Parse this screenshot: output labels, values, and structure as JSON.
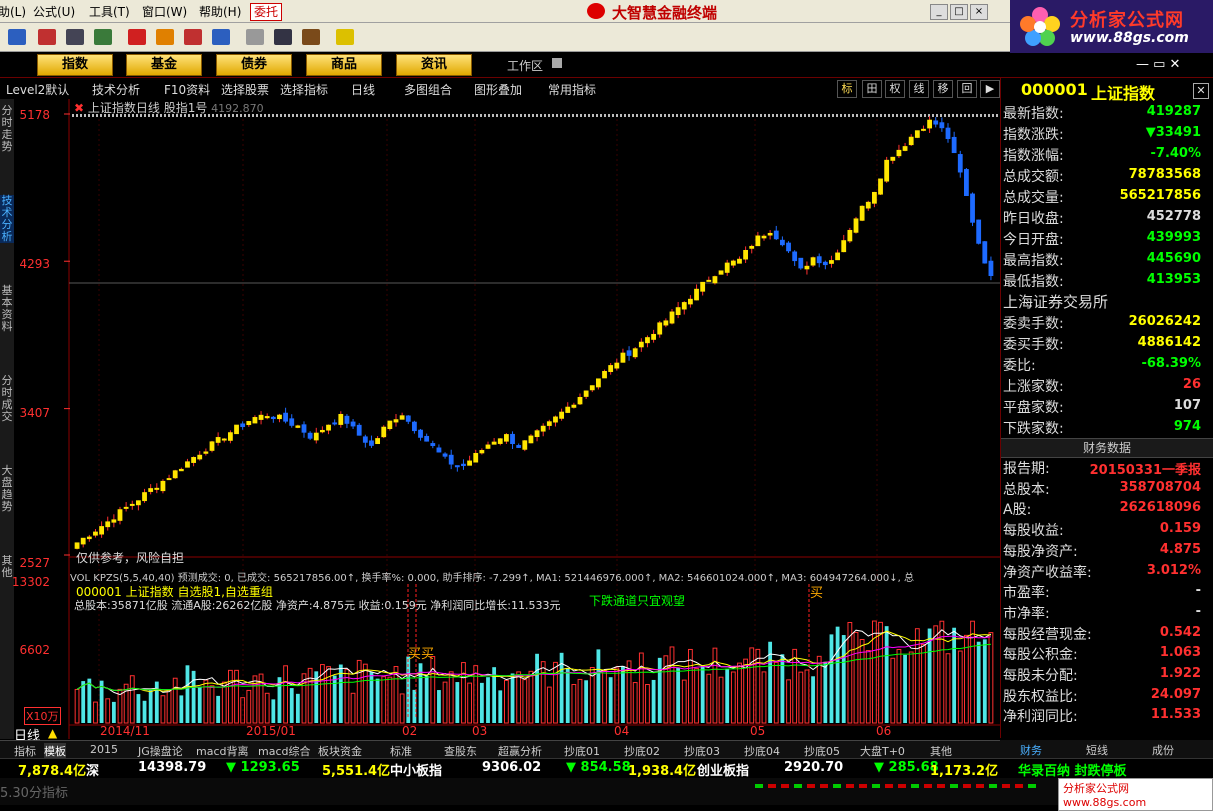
{
  "menu": {
    "items": [
      "助(L)",
      "公式(U)",
      "工具(T)",
      "窗口(W)",
      "帮助(H)"
    ],
    "trust_button": "委托",
    "app_title": "大智慧金融终端"
  },
  "brand": {
    "name": "分析家公式网",
    "url": "www.88gs.com"
  },
  "nav": {
    "tabs": [
      "指数",
      "基金",
      "债券",
      "商品",
      "资讯"
    ],
    "workarea": "工作区"
  },
  "subbar": {
    "items": [
      "Level2默认",
      "技术分析",
      "F10资料",
      "选择股票",
      "选择指标",
      "日线",
      "多图组合",
      "图形叠加",
      "常用指标"
    ],
    "right_buttons": [
      "标",
      "田",
      "权",
      "线",
      "移",
      "回",
      "▶"
    ]
  },
  "left_tabs": [
    "分时走势",
    "技术分析",
    "基本资料",
    "分时成交",
    "大盘趋势",
    "其他"
  ],
  "chart": {
    "header": "上证指数日线 股指1号",
    "header_value": "4192.870",
    "y_labels": [
      "5178",
      "4293",
      "3407",
      "2527"
    ],
    "vol_labels": [
      "13302",
      "6602",
      "X10万"
    ],
    "risk_note": "仅供参考，风险自担",
    "indicator_line": "VOL KPZS(5,5,40,40) 预测成交: 0, 已成交: 565217856.00↑, 换手率%: 0.000, 助手排序: -7.299↑, MA1: 521446976.000↑, MA2: 546601024.000↑, MA3: 604947264.000↓, 总",
    "stock_line": "000001 上证指数 自选股1,自选重组",
    "fund_line": "总股本:35871亿股 流通A股:26262亿股 净资产:4.875元 收益:0.159元 净利润同比增长:11.533元",
    "signal_text": "下跌通道只宜观望",
    "buy_labels": [
      "买买",
      "买"
    ],
    "x_labels": [
      "2014/11",
      "2015/01",
      "02",
      "03",
      "04",
      "05",
      "06"
    ],
    "period_label": "日线"
  },
  "right_panel": {
    "title_code": "000001",
    "title_name": "上证指数",
    "quote": [
      {
        "label": "最新指数:",
        "value": "419287",
        "color": "#00ff00"
      },
      {
        "label": "指数涨跌:",
        "value": "▼33491",
        "color": "#00ff00"
      },
      {
        "label": "指数涨幅:",
        "value": "-7.40%",
        "color": "#00ff00"
      },
      {
        "label": "总成交额:",
        "value": "78783568",
        "color": "#ffff00"
      },
      {
        "label": "总成交量:",
        "value": "565217856",
        "color": "#ffff00"
      },
      {
        "label": "昨日收盘:",
        "value": "452778",
        "color": "#dddddd"
      },
      {
        "label": "今日开盘:",
        "value": "439993",
        "color": "#00ff00"
      },
      {
        "label": "最高指数:",
        "value": "445690",
        "color": "#00ff00"
      },
      {
        "label": "最低指数:",
        "value": "413953",
        "color": "#00ff00"
      }
    ],
    "exchange": "上海证券交易所",
    "market": [
      {
        "label": "委卖手数:",
        "value": "26026242",
        "color": "#ffff00"
      },
      {
        "label": "委买手数:",
        "value": "4886142",
        "color": "#ffff00"
      },
      {
        "label": "委比:",
        "value": "-68.39%",
        "color": "#00ff00"
      },
      {
        "label": "上涨家数:",
        "value": "26",
        "color": "#ff3030"
      },
      {
        "label": "平盘家数:",
        "value": "107",
        "color": "#dddddd"
      },
      {
        "label": "下跌家数:",
        "value": "974",
        "color": "#00ff00"
      }
    ],
    "finance_header": "财务数据",
    "finance": [
      {
        "label": "报告期:",
        "value": "20150331一季报",
        "color": "#ff3030"
      },
      {
        "label": "总股本:",
        "value": "358708704",
        "color": "#ff3030"
      },
      {
        "label": "A股:",
        "value": "262618096",
        "color": "#ff3030"
      },
      {
        "label": "每股收益:",
        "value": "0.159",
        "color": "#ff3030"
      },
      {
        "label": "每股净资产:",
        "value": "4.875",
        "color": "#ff3030"
      },
      {
        "label": "净资产收益率:",
        "value": "3.012%",
        "color": "#ff3030"
      },
      {
        "label": "市盈率:",
        "value": "-",
        "color": "#dddddd"
      },
      {
        "label": "市净率:",
        "value": "-",
        "color": "#dddddd"
      },
      {
        "label": "每股经营现金:",
        "value": "0.542",
        "color": "#ff3030"
      },
      {
        "label": "每股公积金:",
        "value": "1.063",
        "color": "#ff3030"
      },
      {
        "label": "每股未分配:",
        "value": "1.922",
        "color": "#ff3030"
      },
      {
        "label": "股东权益比:",
        "value": "24.097",
        "color": "#ff3030"
      },
      {
        "label": "净利润同比:",
        "value": "11.533",
        "color": "#ff3030"
      }
    ],
    "bottom_tabs": [
      "财务",
      "短线",
      "成份"
    ]
  },
  "bottom_tabs": [
    "指标",
    "模板",
    "2015",
    "JG操盘论",
    "macd背离",
    "macd综合",
    "板块资金",
    "标准",
    "查股东",
    "超赢分析",
    "抄底01",
    "抄底02",
    "抄底03",
    "抄底04",
    "抄底05",
    "大盘T+0",
    "其他"
  ],
  "ticker": [
    {
      "text": "7,878.4亿",
      "color": "#ffff00"
    },
    {
      "text": "深",
      "color": "#ffffff"
    },
    {
      "text": "14398.79",
      "color": "#ffffff"
    },
    {
      "text": "▼ 1293.65",
      "color": "#00ff00"
    },
    {
      "text": "5,551.4亿",
      "color": "#ffff00"
    },
    {
      "text": "中小板指",
      "color": "#ffffff"
    },
    {
      "text": "9306.02",
      "color": "#ffffff"
    },
    {
      "text": "▼ 854.58",
      "color": "#00ff00"
    },
    {
      "text": "1,938.4亿",
      "color": "#ffff00"
    },
    {
      "text": "创业板指",
      "color": "#ffffff"
    },
    {
      "text": "2920.70",
      "color": "#ffffff"
    },
    {
      "text": "▼ 285.68",
      "color": "#00ff00"
    },
    {
      "text": "1,173.2亿",
      "color": "#ffff00"
    },
    {
      "text": "华录百纳 封跌停板",
      "color": "#00ff00"
    }
  ],
  "status": {
    "left": "5.30分指标",
    "watermark": "分析家公式网 www.88gs.com"
  },
  "chart_data": {
    "type": "candlestick",
    "title": "上证指数日线",
    "ylim": [
      2527,
      5178
    ],
    "y_ticks": [
      2527,
      3407,
      4293,
      5178
    ],
    "x_labels": [
      "2014/11",
      "2015/01",
      "02",
      "03",
      "04",
      "05",
      "06"
    ],
    "close_path": [
      2600,
      2660,
      2720,
      2790,
      2850,
      2920,
      2980,
      3050,
      3120,
      3180,
      3240,
      3300,
      3350,
      3370,
      3340,
      3300,
      3230,
      3310,
      3360,
      3260,
      3180,
      3310,
      3380,
      3280,
      3190,
      3100,
      3050,
      3120,
      3200,
      3250,
      3180,
      3240,
      3310,
      3390,
      3470,
      3560,
      3640,
      3720,
      3780,
      3860,
      3940,
      4030,
      4110,
      4200,
      4270,
      4300,
      4420,
      4480,
      4400,
      4230,
      4320,
      4270,
      4420,
      4580,
      4700,
      4910,
      4980,
      5080,
      5140,
      5060,
      4800,
      4450,
      4192
    ],
    "volume": {
      "ylim": [
        0,
        13302
      ],
      "y_ticks": [
        6602,
        13302
      ],
      "unit": "X10万",
      "MA1": 521446976.0,
      "MA2": 546601024.0,
      "MA3": 604947264.0,
      "traded": 565217856.0
    }
  }
}
